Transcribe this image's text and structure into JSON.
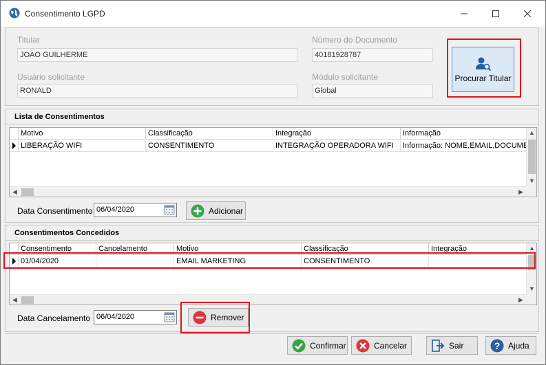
{
  "window": {
    "title": "Consentimento LGPD"
  },
  "header": {
    "titular_label": "Titular",
    "titular_value": "JOAO GUILHERME",
    "documento_label": "Número do Documento",
    "documento_value": "40181928787",
    "usuario_label": "Usuário solicitante",
    "usuario_value": "RONALD",
    "modulo_label": "Módulo solicitante",
    "modulo_value": "Global",
    "procurar_label": "Procurar Titular"
  },
  "lista": {
    "title": "Lista de Consentimentos",
    "columns": [
      "Motivo",
      "Classificação",
      "Integração",
      "Informação"
    ],
    "rows": [
      [
        "LIBERAÇÃO WIFI",
        "CONSENTIMENTO",
        "INTEGRAÇÃO OPERADORA WIFI",
        "Informação: NOME,EMAIL,DOCUME"
      ]
    ],
    "date_label": "Data Consentimento",
    "date_value": "06/04/2020",
    "add_label": "Adicionar"
  },
  "concedidos": {
    "title": "Consentimentos Concedidos",
    "columns": [
      "Consentimento",
      "Cancelamento",
      "Motivo",
      "Classificação",
      "Integração"
    ],
    "rows": [
      [
        "01/04/2020",
        "",
        "EMAIL MARKETING",
        "CONSENTIMENTO",
        ""
      ]
    ],
    "date_label": "Data Cancelamento",
    "date_value": "06/04/2020",
    "remove_label": "Remover"
  },
  "footer": {
    "confirmar": "Confirmar",
    "cancelar": "Cancelar",
    "sair": "Sair",
    "ajuda": "Ajuda"
  },
  "colors": {
    "highlight_red": "#e0141e",
    "accent_blue": "#4a8fd4",
    "confirm_green": "#3aa34a",
    "cancel_red": "#d9363e"
  },
  "icons": [
    "globe-icon",
    "minimize-icon",
    "maximize-icon",
    "close-icon",
    "user-search-icon",
    "calendar-icon",
    "add-icon",
    "remove-icon",
    "confirm-icon",
    "cancel-icon",
    "exit-icon",
    "help-icon"
  ]
}
